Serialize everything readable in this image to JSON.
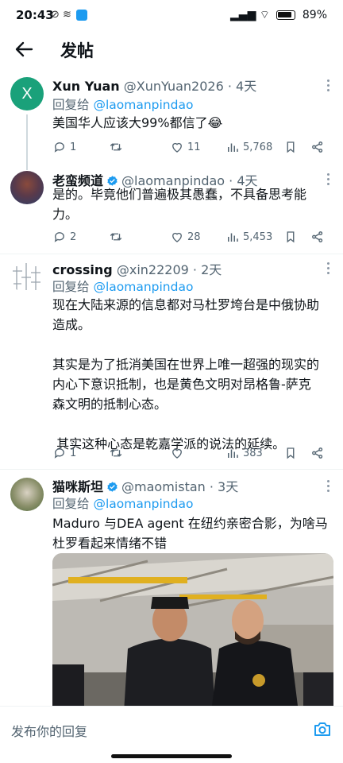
{
  "status_bar": {
    "time": "20:43",
    "battery": "89%"
  },
  "header": {
    "title": "发帖"
  },
  "tweets": [
    {
      "avatar_letter": "X",
      "name": "Xun Yuan",
      "handle": "@XunYuan2026",
      "time": "· 4天",
      "reply_prefix": "回复给",
      "reply_handle": "@laomanpindao",
      "text": "美国华人应该大99%都信了😂",
      "replies": "1",
      "retweets": "",
      "likes": "11",
      "views": "5,768"
    },
    {
      "name": "老蛮频道",
      "handle": "@laomanpindao",
      "time": "· 4天",
      "text": "是的。毕竟他们普遍极其愚蠢，不具备思考能\n力。",
      "replies": "2",
      "retweets": "",
      "likes": "28",
      "views": "5,453"
    },
    {
      "name": "crossing",
      "handle": "@xin22209",
      "time": "· 2天",
      "reply_prefix": "回复给",
      "reply_handle": "@laomanpindao",
      "text": "现在大陆来源的信息都对马杜罗垮台是中俄协助\n造成。\n\n其实是为了抵消美国在世界上唯一超强的现实的\n内心下意识抵制，也是黄色文明对昂格鲁-萨克\n森文明的抵制心态。\n\n 其实这种心态是乾嘉学派的说法的延续。",
      "replies": "1",
      "retweets": "",
      "likes": "",
      "views": "383"
    },
    {
      "name": "猫咪斯坦",
      "handle": "@maomistan",
      "time": "· 3天",
      "reply_prefix": "回复给",
      "reply_handle": "@laomanpindao",
      "text": "Maduro 与DEA agent 在纽约亲密合影，为啥马\n杜罗看起来情绪不错"
    }
  ],
  "reply_bar": {
    "placeholder": "发布你的回复"
  },
  "colors": {
    "accent": "#1d9bf0",
    "text": "#0f1419",
    "muted": "#536471"
  }
}
